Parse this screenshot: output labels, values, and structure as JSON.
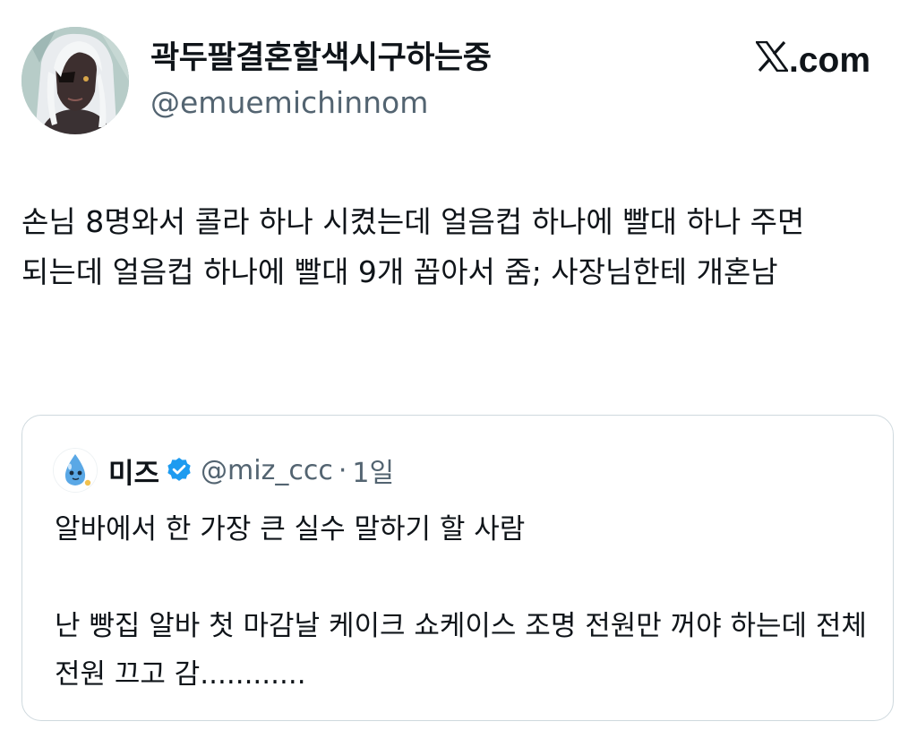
{
  "author": {
    "display_name": "곽두팔결혼할색시구하는중",
    "handle": "@emuemichinnom",
    "avatar_icon": "anime-character-avatar"
  },
  "site": {
    "logo_icon": "x-logo-icon",
    "label": ".com"
  },
  "tweet": {
    "text": "손님 8명와서 콜라 하나 시켰는데 얼음컵 하나에 빨대 하나 주면 되는데 얼음컵 하나에 빨대 9개 꼽아서 줌; 사장님한테 개혼남"
  },
  "quoted_tweet": {
    "display_name": "미즈",
    "verified_icon": "verified-badge-icon",
    "handle": "@miz_ccc",
    "separator": "·",
    "time": "1일",
    "avatar_icon": "blue-droplet-mascot-avatar",
    "paragraph_1": "알바에서 한 가장 큰 실수 말하기 할 사람",
    "paragraph_2": "난 빵집 알바 첫 마감날 케이크 쇼케이스 조명 전원만 꺼야 하는데 전체 전원 끄고 감............"
  },
  "colors": {
    "text_primary": "#0f1419",
    "text_secondary": "#536471",
    "verified_blue": "#1d9bf0",
    "border": "#cfd9de"
  }
}
